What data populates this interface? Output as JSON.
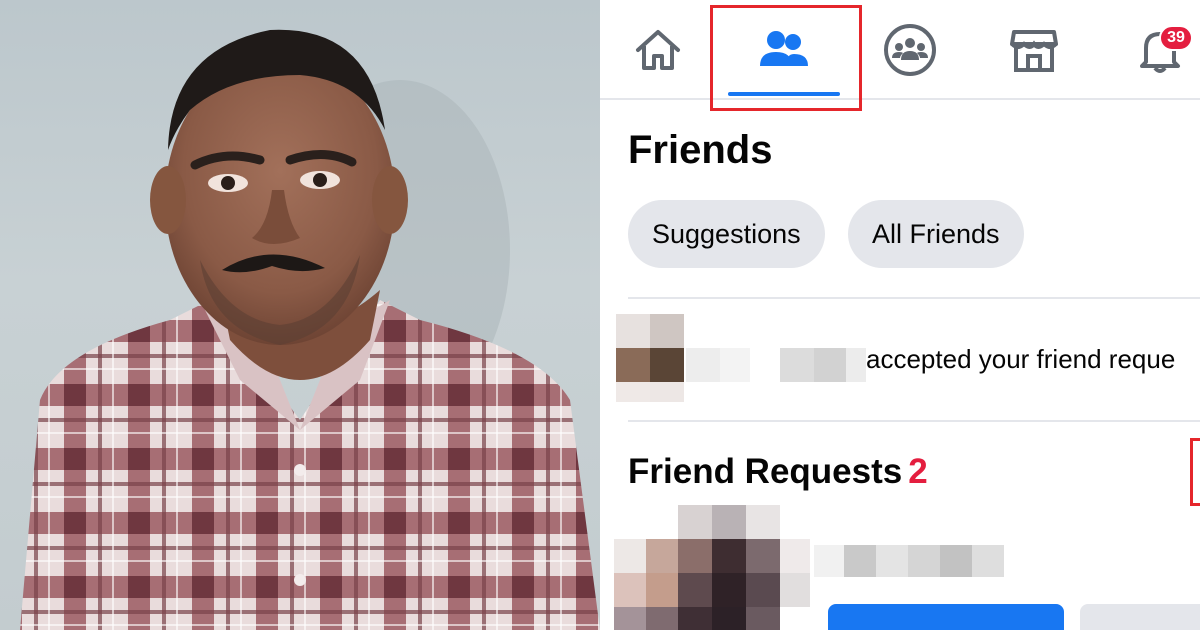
{
  "nav": {
    "tabs": [
      {
        "name": "home",
        "icon": "home-icon"
      },
      {
        "name": "friends",
        "icon": "friends-icon",
        "active": true
      },
      {
        "name": "groups",
        "icon": "groups-icon"
      },
      {
        "name": "marketplace",
        "icon": "marketplace-icon"
      },
      {
        "name": "notifications",
        "icon": "bell-icon"
      }
    ],
    "notification_badge": "39"
  },
  "friends": {
    "title": "Friends",
    "chips": [
      "Suggestions",
      "All Friends"
    ]
  },
  "notification": {
    "text": "accepted your friend reque"
  },
  "friend_requests": {
    "title": "Friend Requests",
    "count": "2"
  },
  "colors": {
    "accent": "#1877f2",
    "badge": "#e41e3f",
    "highlight": "#e5262b",
    "chip": "#e4e6eb",
    "icon": "#606770"
  }
}
